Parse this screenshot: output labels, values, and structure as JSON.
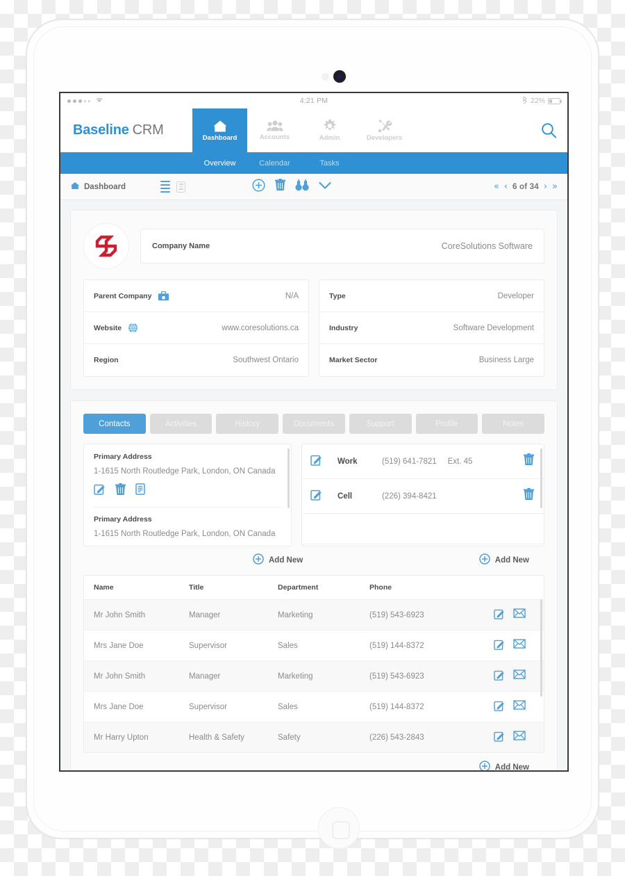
{
  "colors": {
    "accent": "#2f90d4",
    "accent_light": "#4f9fd8",
    "tab_inactive": "#dcdcdc",
    "logo_red": "#cb2030",
    "text_label": "#4c4c4c",
    "text_value": "#8b8b8b"
  },
  "statusbar": {
    "signal_dots_filled": 3,
    "signal_dots_empty": 2,
    "wifi_icon": "wifi-icon",
    "time": "4:21 PM",
    "bluetooth_icon": "bluetooth-icon",
    "battery_percent": "22%",
    "battery_level": 22
  },
  "navbar": {
    "brand_bold": "Baseline",
    "brand_light": "CRM",
    "items": [
      {
        "label": "Dashboard",
        "icon": "home-icon",
        "active": true
      },
      {
        "label": "Accounts",
        "icon": "people-icon",
        "active": false
      },
      {
        "label": "Admin",
        "icon": "gear-icon",
        "active": false
      },
      {
        "label": "Developers",
        "icon": "tools-icon",
        "active": false
      }
    ],
    "search_icon": "search-icon"
  },
  "subnav": {
    "tabs": [
      {
        "label": "Overview",
        "active": true
      },
      {
        "label": "Calendar",
        "active": false
      },
      {
        "label": "Tasks",
        "active": false
      }
    ]
  },
  "toolbar": {
    "breadcrumb_icon": "home-icon",
    "breadcrumb": "Dashboard",
    "view_list_icon": "list-view-icon",
    "view_card_icon": "card-view-icon",
    "actions": [
      {
        "icon": "plus-circle-icon",
        "name": "add-record-button"
      },
      {
        "icon": "trash-icon",
        "name": "delete-record-button"
      },
      {
        "icon": "binoculars-icon",
        "name": "find-record-button"
      },
      {
        "icon": "chevron-down-icon",
        "name": "more-actions-button"
      }
    ],
    "pagination": {
      "first_icon": "first-page-icon",
      "prev_icon": "prev-page-icon",
      "counter": "6 of 34",
      "next_icon": "next-page-icon",
      "last_icon": "last-page-icon"
    }
  },
  "company": {
    "logo_name": "coresolutions-logo",
    "name_label": "Company Name",
    "name_value": "CoreSolutions Software",
    "left_fields": [
      {
        "label": "Parent Company",
        "value": "N/A",
        "icon": "briefcase-icon"
      },
      {
        "label": "Website",
        "value": "www.coresolutions.ca",
        "icon": "globe-icon"
      },
      {
        "label": "Region",
        "value": "Southwest Ontario",
        "icon": null
      }
    ],
    "right_fields": [
      {
        "label": "Type",
        "value": "Developer",
        "icon": null
      },
      {
        "label": "Industry",
        "value": "Software Development",
        "icon": null
      },
      {
        "label": "Market Sector",
        "value": "Business Large",
        "icon": null
      }
    ]
  },
  "detail_tabs": [
    {
      "label": "Contacts",
      "active": true
    },
    {
      "label": "Activities",
      "active": false
    },
    {
      "label": "History",
      "active": false
    },
    {
      "label": "Documents",
      "active": false
    },
    {
      "label": "Support",
      "active": false
    },
    {
      "label": "Profile",
      "active": false
    },
    {
      "label": "Notes",
      "active": false
    }
  ],
  "addresses": [
    {
      "title": "Primary Address",
      "line": "1-1615 North Routledge Park, London, ON Canada",
      "icons": [
        "edit-icon",
        "trash-icon",
        "document-icon"
      ]
    },
    {
      "title": "Primary Address",
      "line": "1-1615 North Routledge Park, London, ON Canada",
      "icons": []
    }
  ],
  "phones": [
    {
      "edit_icon": "edit-icon",
      "type": "Work",
      "number": "(519) 641-7821",
      "ext": "Ext. 45",
      "delete_icon": "trash-icon"
    },
    {
      "edit_icon": "edit-icon",
      "type": "Cell",
      "number": "(226) 394-8421",
      "ext": "",
      "delete_icon": "trash-icon"
    }
  ],
  "add_new": {
    "icon": "plus-circle-icon",
    "label": "Add New"
  },
  "contacts_table": {
    "columns": [
      "Name",
      "Title",
      "Department",
      "Phone"
    ],
    "rows": [
      {
        "name": "Mr John Smith",
        "title": "Manager",
        "department": "Marketing",
        "phone": "(519) 543-6923"
      },
      {
        "name": "Mrs Jane Doe",
        "title": "Supervisor",
        "department": "Sales",
        "phone": "(519) 144-8372"
      },
      {
        "name": "Mr John Smith",
        "title": "Manager",
        "department": "Marketing",
        "phone": "(519) 543-6923"
      },
      {
        "name": "Mrs Jane Doe",
        "title": "Supervisor",
        "department": "Sales",
        "phone": "(519) 144-8372"
      },
      {
        "name": "Mr Harry Upton",
        "title": "Health & Safety",
        "department": "Safety",
        "phone": "(226) 543-2843"
      }
    ],
    "row_icons": [
      "edit-icon",
      "mail-icon"
    ]
  }
}
